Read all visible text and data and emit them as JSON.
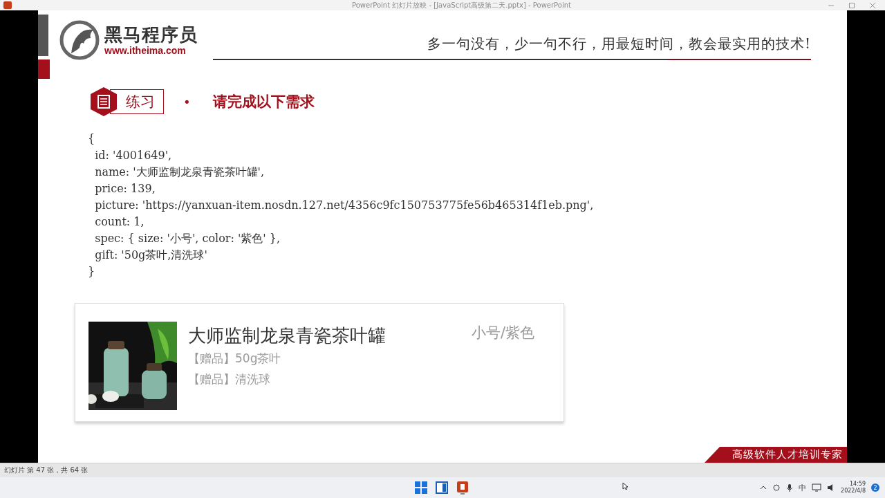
{
  "window": {
    "title": "PowerPoint 幻灯片放映 - [JavaScript高级第二天.pptx] - PowerPoint"
  },
  "slide": {
    "logo": {
      "name": "黑马程序员",
      "url": "www.itheima.com"
    },
    "slogan": "多一句没有，少一句不行，用最短时间，教会最实用的技术!",
    "exercise": {
      "badge": "练习",
      "bullet": "•",
      "heading": "请完成以下需求"
    },
    "code_lines": [
      "{",
      "  id: '4001649',",
      "  name: '大师监制龙泉青瓷茶叶罐',",
      "  price: 139,",
      "  picture: 'https://yanxuan-item.nosdn.127.net/4356c9fc150753775fe56b465314f1eb.png',",
      "  count: 1,",
      "  spec: { size: '小号', color: '紫色' },",
      "  gift: '50g茶叶,清洗球'",
      "}"
    ],
    "product_card": {
      "title": "大师监制龙泉青瓷茶叶罐",
      "gifts": [
        "【赠品】50g茶叶",
        "【赠品】清洗球"
      ],
      "spec": "小号/紫色"
    },
    "footer_banner": "高级软件人才培训专家"
  },
  "status_bar": {
    "text": "幻灯片 第 47 张，共 64 张"
  },
  "taskbar": {
    "ime": "中",
    "time": "14:59",
    "date": "2022/4/8",
    "notification_count": "2"
  }
}
